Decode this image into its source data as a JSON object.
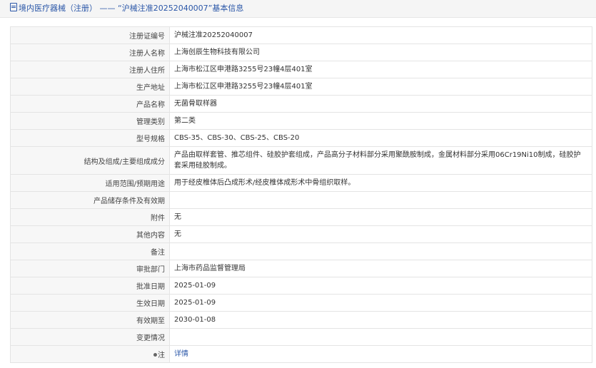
{
  "header": {
    "prefix": "境内医疗器械（注册）",
    "dash": "——",
    "title": "“沪械注准20252040007”基本信息"
  },
  "rows": [
    {
      "label": "注册证编号",
      "value": "沪械注准20252040007"
    },
    {
      "label": "注册人名称",
      "value": "上海创辰生物科技有限公司"
    },
    {
      "label": "注册人住所",
      "value": "上海市松江区申港路3255号23幢4层401室"
    },
    {
      "label": "生产地址",
      "value": "上海市松江区申港路3255号23幢4层401室"
    },
    {
      "label": "产品名称",
      "value": "无菌骨取样器"
    },
    {
      "label": "管理类别",
      "value": "第二类"
    },
    {
      "label": "型号规格",
      "value": "CBS-35、CBS-30、CBS-25、CBS-20"
    },
    {
      "label": "结构及组成/主要组成成分",
      "value": "产品由取样套管、推芯组件、硅胶护套组成，产品高分子材料部分采用聚酰胺制成，金属材料部分采用06Cr19Ni10制成，硅胶护套采用硅胶制成。"
    },
    {
      "label": "适用范围/预期用途",
      "value": "用于经皮椎体后凸成形术/经皮椎体成形术中骨组织取样。"
    },
    {
      "label": "产品储存条件及有效期",
      "value": ""
    },
    {
      "label": "附件",
      "value": "无"
    },
    {
      "label": "其他内容",
      "value": "无"
    },
    {
      "label": "备注",
      "value": ""
    },
    {
      "label": "审批部门",
      "value": "上海市药品监督管理局"
    },
    {
      "label": "批准日期",
      "value": "2025-01-09"
    },
    {
      "label": "生效日期",
      "value": "2025-01-09"
    },
    {
      "label": "有效期至",
      "value": "2030-01-08"
    },
    {
      "label": "变更情况",
      "value": ""
    }
  ],
  "note": {
    "label": "注",
    "link_text": "详情"
  }
}
